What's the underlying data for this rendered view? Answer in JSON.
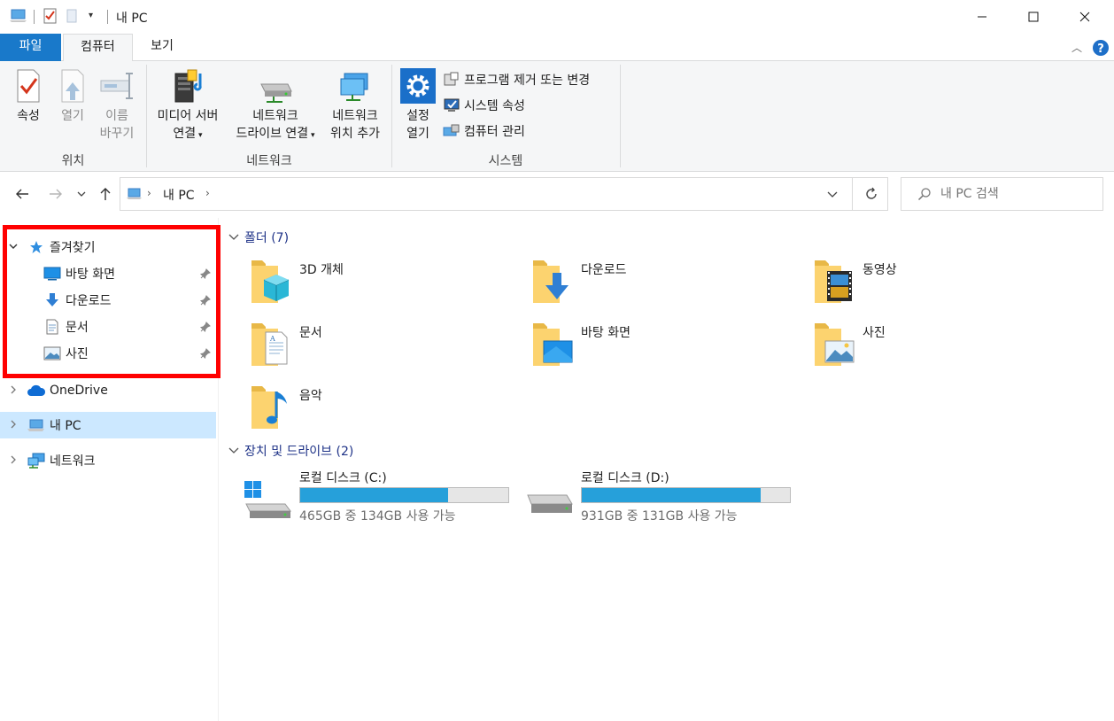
{
  "window": {
    "title": "내 PC"
  },
  "tabs": {
    "file": "파일",
    "computer": "컴퓨터",
    "view": "보기"
  },
  "ribbon": {
    "location": {
      "label": "위치",
      "properties": "속성",
      "open": "열기",
      "rename_line1": "이름",
      "rename_line2": "바꾸기"
    },
    "network": {
      "label": "네트워크",
      "media_line1": "미디어 서버",
      "media_line2": "연결",
      "map_drive_line1": "네트워크",
      "map_drive_line2": "드라이브 연결",
      "add_location_line1": "네트워크",
      "add_location_line2": "위치 추가"
    },
    "system": {
      "label": "시스템",
      "settings_line1": "설정",
      "settings_line2": "열기",
      "uninstall": "프로그램 제거 또는 변경",
      "system_properties": "시스템 속성",
      "manage": "컴퓨터 관리"
    }
  },
  "address": {
    "path": "내 PC",
    "search_placeholder": "내 PC 검색"
  },
  "nav": {
    "quick_access": "즐겨찾기",
    "pinned": [
      {
        "label": "바탕 화면",
        "icon": "desktop-icon"
      },
      {
        "label": "다운로드",
        "icon": "download-icon"
      },
      {
        "label": "문서",
        "icon": "documents-icon"
      },
      {
        "label": "사진",
        "icon": "pictures-icon"
      }
    ],
    "onedrive": "OneDrive",
    "this_pc": "내 PC",
    "network": "네트워크"
  },
  "folders": {
    "header": "폴더 (7)",
    "items": [
      {
        "label": "3D 개체",
        "icon": "3d-objects-folder-icon"
      },
      {
        "label": "다운로드",
        "icon": "downloads-folder-icon"
      },
      {
        "label": "동영상",
        "icon": "videos-folder-icon"
      },
      {
        "label": "문서",
        "icon": "documents-folder-icon"
      },
      {
        "label": "바탕 화면",
        "icon": "desktop-folder-icon"
      },
      {
        "label": "사진",
        "icon": "pictures-folder-icon"
      },
      {
        "label": "음악",
        "icon": "music-folder-icon"
      }
    ]
  },
  "drives": {
    "header": "장치 및 드라이브 (2)",
    "items": [
      {
        "name": "로컬 디스크 (C:)",
        "info": "465GB 중 134GB 사용 가능",
        "used_fraction": 0.712
      },
      {
        "name": "로컬 디스크 (D:)",
        "info": "931GB 중 131GB 사용 가능",
        "used_fraction": 0.859
      }
    ]
  },
  "colors": {
    "accent": "#1979ca",
    "selection": "#cce8ff",
    "drive_fill": "#26a0da",
    "highlight_box": "#ff0000"
  }
}
